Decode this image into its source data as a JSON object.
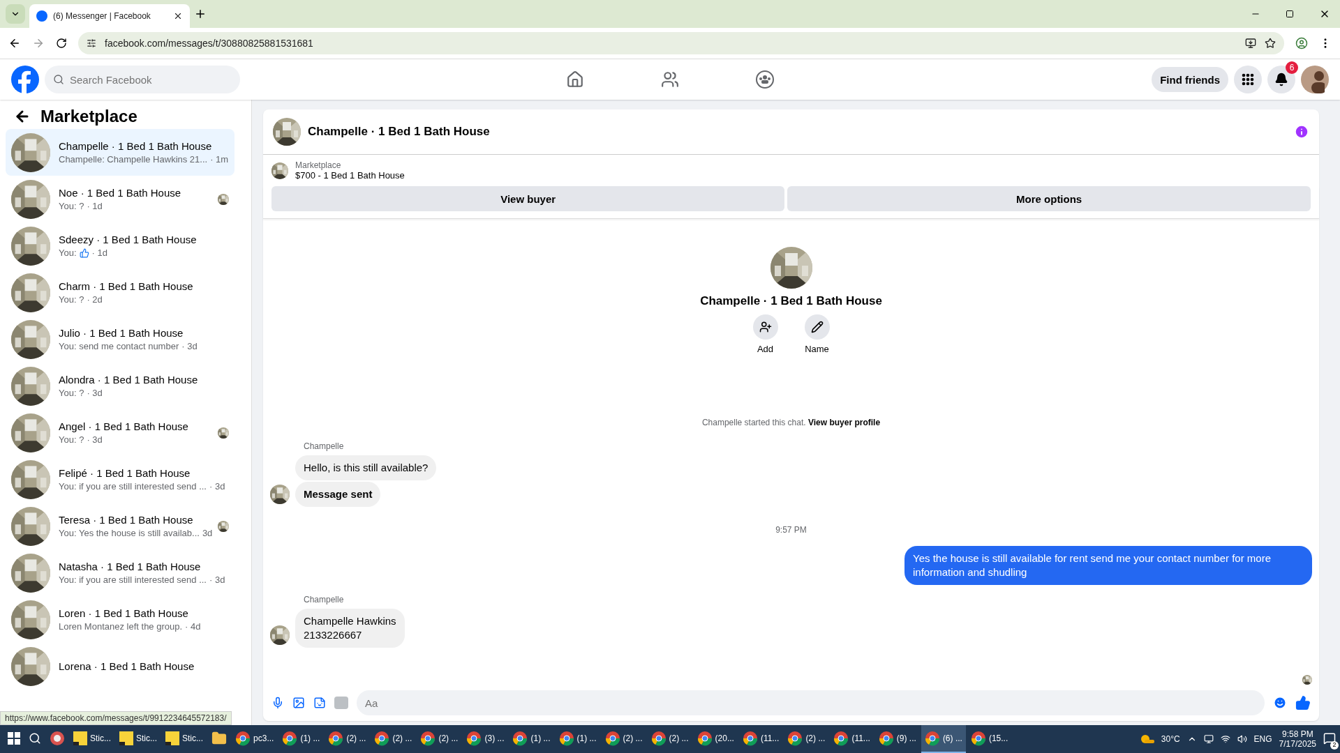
{
  "browser": {
    "tab_title": "(6) Messenger | Facebook",
    "url": "facebook.com/messages/t/30880825881531681"
  },
  "header": {
    "search_placeholder": "Search Facebook",
    "find_friends": "Find friends",
    "notification_count": "6"
  },
  "sidebar": {
    "title": "Marketplace",
    "conversations": [
      {
        "name": "Champelle · 1 Bed 1 Bath House",
        "preview": "Champelle: Champelle Hawkins 21...",
        "time": "· 1m",
        "selected": true,
        "seen": false
      },
      {
        "name": "Noe · 1 Bed 1 Bath House",
        "preview": "You: ?",
        "time": "· 1d",
        "selected": false,
        "seen": true
      },
      {
        "name": "Sdeezy · 1 Bed 1 Bath House",
        "preview": "You:",
        "kind": "like",
        "time": "· 1d",
        "selected": false,
        "seen": false
      },
      {
        "name": "Charm · 1 Bed 1 Bath House",
        "preview": "You: ?",
        "time": "· 2d",
        "selected": false,
        "seen": false
      },
      {
        "name": "Julio · 1 Bed 1 Bath House",
        "preview": "You: send me contact number",
        "time": "· 3d",
        "selected": false,
        "seen": false
      },
      {
        "name": "Alondra · 1 Bed 1 Bath House",
        "preview": "You: ?",
        "time": "· 3d",
        "selected": false,
        "seen": false
      },
      {
        "name": "Angel · 1 Bed 1 Bath House",
        "preview": "You: ?",
        "time": "· 3d",
        "selected": false,
        "seen": true
      },
      {
        "name": "Felipé · 1 Bed 1 Bath House",
        "preview": "You: if you are still interested send ...",
        "time": "· 3d",
        "selected": false,
        "seen": false
      },
      {
        "name": "Teresa · 1 Bed 1 Bath House",
        "preview": "You: Yes the house is still availab...",
        "time": "3d",
        "selected": false,
        "seen": true
      },
      {
        "name": "Natasha · 1 Bed 1 Bath House",
        "preview": "You: if you are still interested send ...",
        "time": "· 3d",
        "selected": false,
        "seen": false
      },
      {
        "name": "Loren · 1 Bed 1 Bath House",
        "preview": "Loren Montanez left the group.",
        "time": "· 4d",
        "selected": false,
        "seen": false
      },
      {
        "name": "Lorena · 1 Bed 1 Bath House",
        "selected": false,
        "seen": false
      }
    ]
  },
  "status_url": "https://www.facebook.com/messages/t/9912234645572183/",
  "chat": {
    "title": "Champelle · 1 Bed 1 Bath House",
    "listing": {
      "label": "Marketplace",
      "title": "$700 - 1 Bed 1 Bath House"
    },
    "buttons": [
      "View buyer",
      "More options"
    ],
    "profile": {
      "name": "Champelle · 1 Bed 1 Bath House",
      "actions": [
        {
          "kind": "add",
          "label": "Add"
        },
        {
          "kind": "name",
          "label": "Name"
        }
      ]
    },
    "system": {
      "text": "Champelle started this chat.",
      "link": "View buyer profile"
    },
    "messages": [
      {
        "kind": "incoming",
        "sender": "Champelle",
        "bubbles": [
          {
            "text": "Hello, is this still available?",
            "bold": false
          },
          {
            "text": "Message sent",
            "bold": true
          }
        ]
      },
      {
        "kind": "time",
        "text": "9:57 PM"
      },
      {
        "kind": "outgoing",
        "bubbles": [
          {
            "text": "Yes the house is still available for rent send me your contact number for more information and shudling",
            "bold": false
          }
        ]
      },
      {
        "kind": "incoming",
        "sender": "Champelle",
        "bubbles": [
          {
            "text": "Champelle Hawkins\n2133226667",
            "bold": false
          }
        ]
      }
    ],
    "composer": {
      "placeholder": "Aa"
    }
  },
  "taskbar": {
    "items": [
      {
        "kind": "app",
        "selected": false
      },
      {
        "kind": "note",
        "label": "Stic...",
        "selected": false
      },
      {
        "kind": "note",
        "label": "Stic...",
        "selected": false
      },
      {
        "kind": "note",
        "label": "Stic...",
        "selected": false
      },
      {
        "kind": "folder",
        "selected": false
      },
      {
        "kind": "browser",
        "label": "pc3...",
        "selected": false
      },
      {
        "kind": "browser",
        "label": "(1) ...",
        "selected": false
      },
      {
        "kind": "browser",
        "label": "(2) ...",
        "selected": false
      },
      {
        "kind": "browser",
        "label": "(2) ...",
        "selected": false
      },
      {
        "kind": "browser",
        "label": "(2) ...",
        "selected": false
      },
      {
        "kind": "browser",
        "label": "(3) ...",
        "selected": false
      },
      {
        "kind": "browser",
        "label": "(1) ...",
        "selected": false
      },
      {
        "kind": "browser",
        "label": "(1) ...",
        "selected": false
      },
      {
        "kind": "browser",
        "label": "(2) ...",
        "selected": false
      },
      {
        "kind": "browser",
        "label": "(2) ...",
        "selected": false
      },
      {
        "kind": "browser",
        "label": "(20...",
        "selected": false
      },
      {
        "kind": "browser",
        "label": "(11...",
        "selected": false
      },
      {
        "kind": "browser",
        "label": "(2) ...",
        "selected": false
      },
      {
        "kind": "browser",
        "label": "(11...",
        "selected": false
      },
      {
        "kind": "browser",
        "label": "(9) ...",
        "selected": false
      },
      {
        "kind": "browser",
        "label": "(6) ...",
        "selected": true
      },
      {
        "kind": "browser",
        "label": "(15...",
        "selected": false
      }
    ],
    "temperature": "30°C",
    "language": "ENG",
    "time": "9:58 PM",
    "date": "7/17/2025",
    "notifications": "2"
  }
}
